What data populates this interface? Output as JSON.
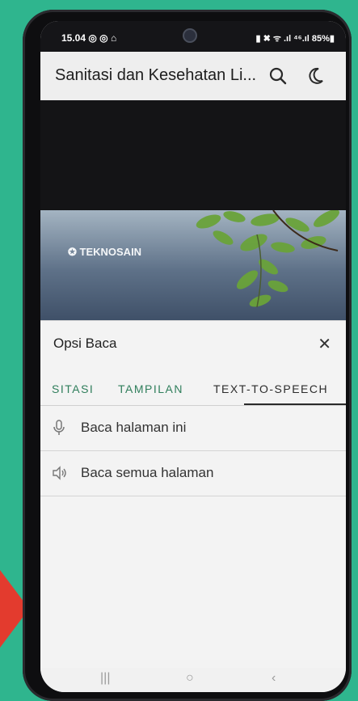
{
  "status": {
    "time": "15.04 ◎ ◎ ⌂",
    "system": "▮ ✖ ᯤ .ıl ⁴⁶.ıl 85%▮"
  },
  "appbar": {
    "title": "Sanitasi dan Kesehatan Li...",
    "search_icon": "search-icon",
    "theme_icon": "moon-icon"
  },
  "banner": {
    "brand": "✪ TEKNOSAIN"
  },
  "sheet": {
    "title": "Opsi Baca",
    "close": "✕",
    "tabs": [
      {
        "label": "SITASI",
        "active": false
      },
      {
        "label": "TAMPILAN",
        "active": false
      },
      {
        "label": "TEXT-TO-SPEECH",
        "active": true
      }
    ],
    "options": [
      {
        "label": "Baca halaman ini",
        "icon": "microphone-icon"
      },
      {
        "label": "Baca semua halaman",
        "icon": "speaker-icon"
      }
    ]
  },
  "nav": {
    "recent": "|||",
    "home": "○",
    "back": "‹"
  },
  "colors": {
    "background": "#2fb58e",
    "accent": "#2f7e5b",
    "arrow": "#e33b2e"
  }
}
